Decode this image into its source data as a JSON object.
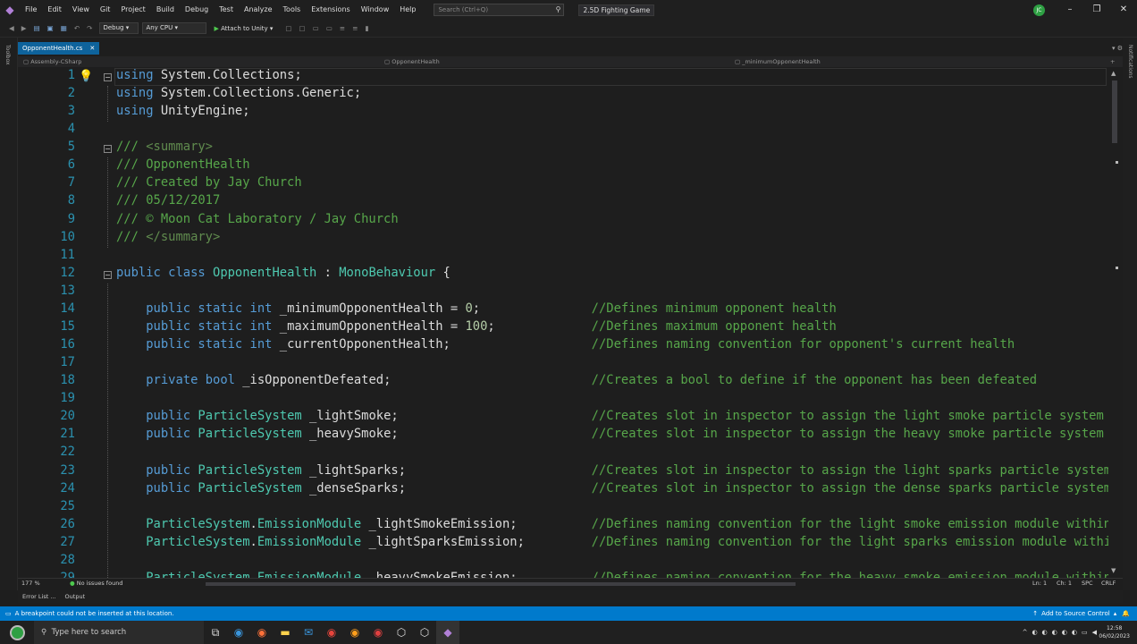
{
  "titlebar": {
    "menus": [
      "File",
      "Edit",
      "View",
      "Git",
      "Project",
      "Build",
      "Debug",
      "Test",
      "Analyze",
      "Tools",
      "Extensions",
      "Window",
      "Help"
    ],
    "search_placeholder": "Search (Ctrl+Q)",
    "project_name": "2.5D Fighting Game",
    "avatar_initials": "JC"
  },
  "toolbar": {
    "configuration": "Debug",
    "platform": "Any CPU",
    "attach_label": "Attach to Unity"
  },
  "left_tool_label": "Toolbox",
  "right_tool_label": "Notifications",
  "tab": {
    "label": "OpponentHealth.cs"
  },
  "navbar": {
    "project": "Assembly-CSharp",
    "class": "OpponentHealth",
    "member": "_minimumOpponentHealth"
  },
  "code_lines": [
    {
      "n": "1",
      "text": "using System.Collections;"
    },
    {
      "n": "2",
      "text": "using System.Collections.Generic;"
    },
    {
      "n": "3",
      "text": "using UnityEngine;"
    },
    {
      "n": "4",
      "text": ""
    },
    {
      "n": "5",
      "text": "/// <summary>"
    },
    {
      "n": "6",
      "text": "/// OpponentHealth"
    },
    {
      "n": "7",
      "text": "/// Created by Jay Church"
    },
    {
      "n": "8",
      "text": "/// 05/12/2017"
    },
    {
      "n": "9",
      "text": "/// © Moon Cat Laboratory / Jay Church"
    },
    {
      "n": "10",
      "text": "/// </summary>"
    },
    {
      "n": "11",
      "text": ""
    },
    {
      "n": "12",
      "text": "public class OpponentHealth : MonoBehaviour {"
    },
    {
      "n": "13",
      "text": ""
    },
    {
      "n": "14",
      "text": "    public static int _minimumOpponentHealth = 0;               //Defines minimum opponent health"
    },
    {
      "n": "15",
      "text": "    public static int _maximumOpponentHealth = 100;             //Defines maximum opponent health"
    },
    {
      "n": "16",
      "text": "    public static int _currentOpponentHealth;                   //Defines naming convention for opponent's current health"
    },
    {
      "n": "17",
      "text": ""
    },
    {
      "n": "18",
      "text": "    private bool _isOpponentDefeated;                           //Creates a bool to define if the opponent has been defeated"
    },
    {
      "n": "19",
      "text": ""
    },
    {
      "n": "20",
      "text": "    public ParticleSystem _lightSmoke;                          //Creates slot in inspector to assign the light smoke particle system"
    },
    {
      "n": "21",
      "text": "    public ParticleSystem _heavySmoke;                          //Creates slot in inspector to assign the heavy smoke particle system"
    },
    {
      "n": "22",
      "text": ""
    },
    {
      "n": "23",
      "text": "    public ParticleSystem _lightSparks;                         //Creates slot in inspector to assign the light sparks particle system"
    },
    {
      "n": "24",
      "text": "    public ParticleSystem _denseSparks;                         //Creates slot in inspector to assign the dense sparks particle system"
    },
    {
      "n": "25",
      "text": ""
    },
    {
      "n": "26",
      "text": "    ParticleSystem.EmissionModule _lightSmokeEmission;          //Defines naming convention for the light smoke emission module within"
    },
    {
      "n": "27",
      "text": "    ParticleSystem.EmissionModule _lightSparksEmission;         //Defines naming convention for the light sparks emission module within"
    },
    {
      "n": "28",
      "text": ""
    },
    {
      "n": "29",
      "text": "    ParticleSystem.EmissionModule _heavySmokeEmission;          //Defines naming convention for the heavy smoke emission module within"
    }
  ],
  "status_strip": {
    "zoom": "177 %",
    "issues": "No issues found",
    "line": "Ln: 1",
    "col": "Ch: 1",
    "whitespace": "SPC",
    "line_ending": "CRLF"
  },
  "bottom_tabs": [
    "Error List ...",
    "Output"
  ],
  "statusbar": {
    "message": "A breakpoint could not be inserted at this location.",
    "source_control": "Add to Source Control"
  },
  "taskbar": {
    "search_placeholder": "Type here to search",
    "time": "12:58",
    "date": "06/02/2023"
  },
  "colors": {
    "keyword": "#569cd6",
    "type": "#4ec9b0",
    "comment": "#57a64a",
    "number": "#b5cea8",
    "line_number": "#2b91af",
    "statusbar": "#007acc"
  }
}
